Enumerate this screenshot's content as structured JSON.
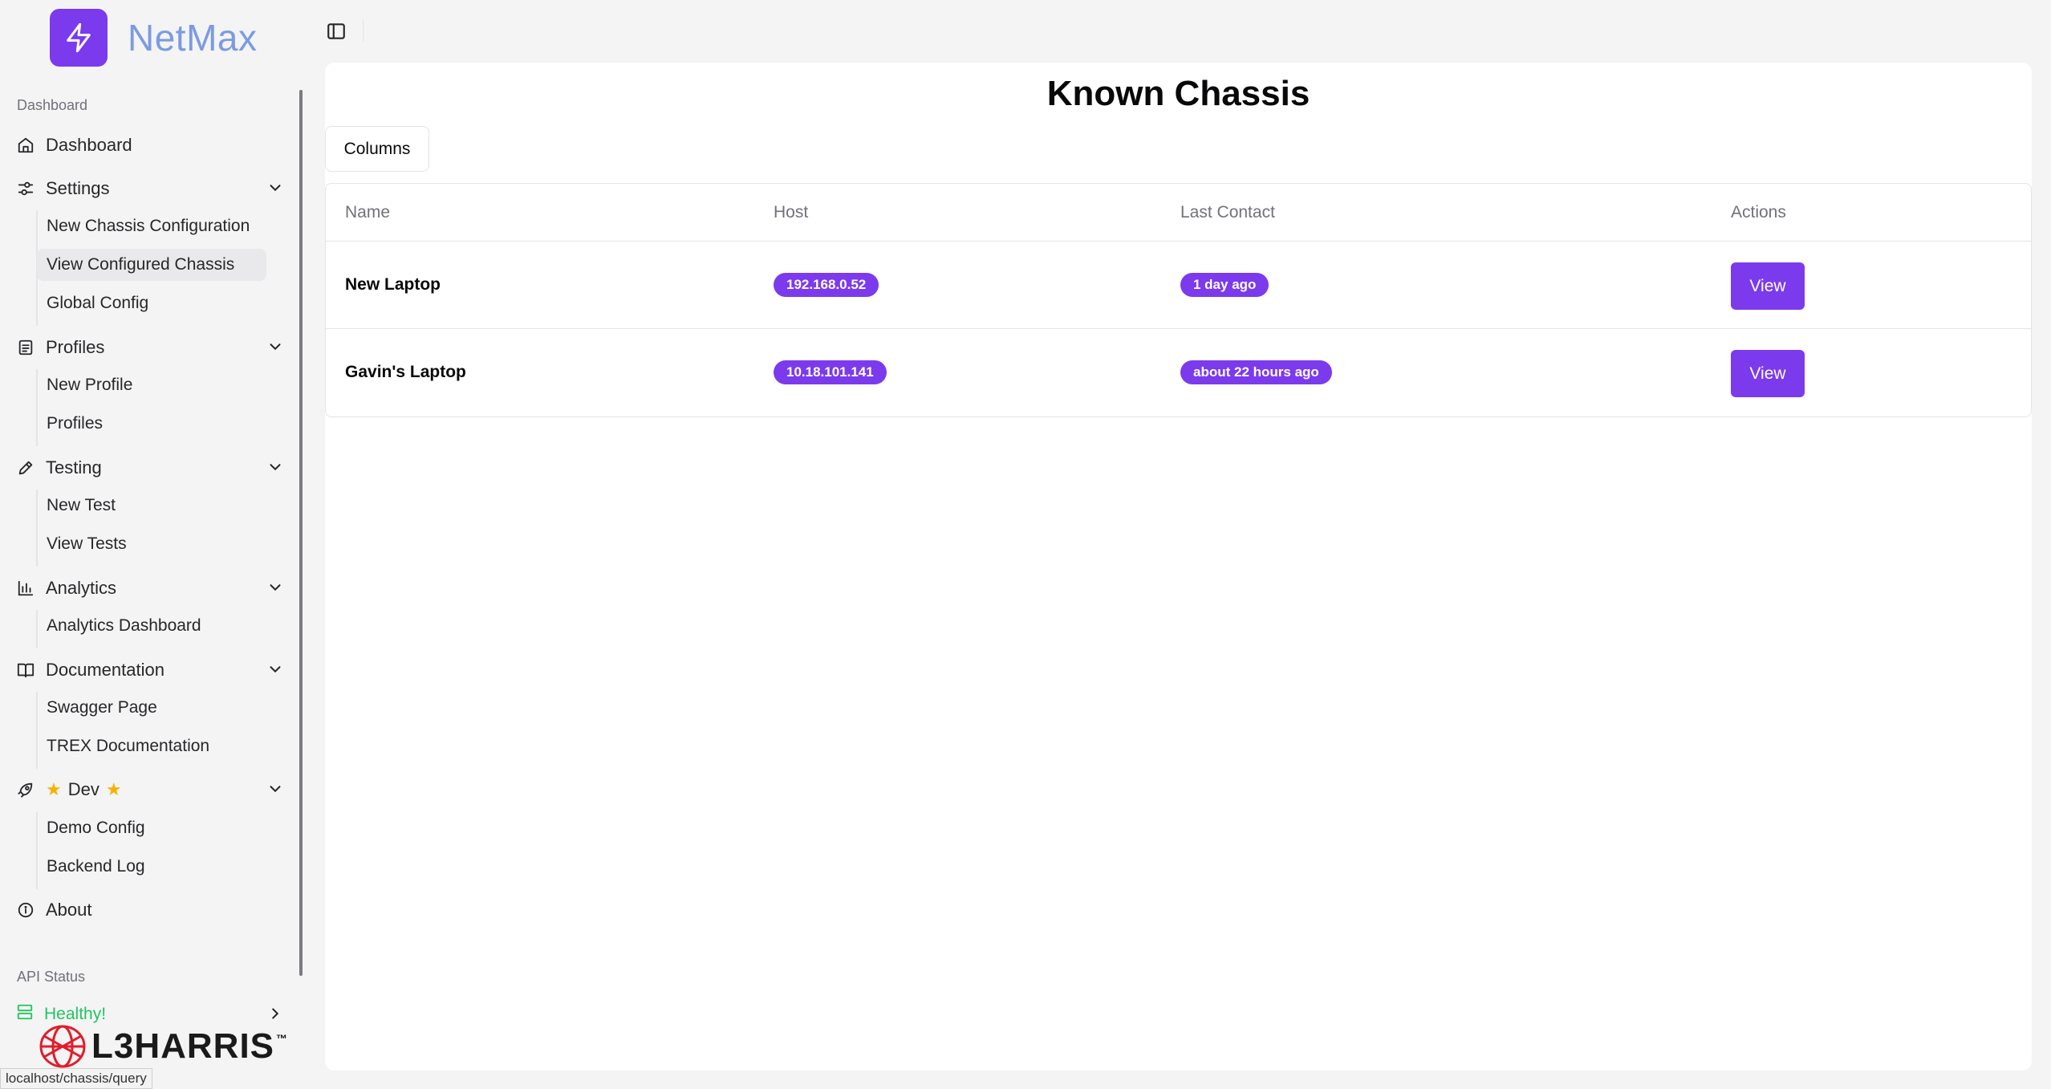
{
  "brand": {
    "name": "NetMax",
    "logo_icon": "lightning-bolt-icon",
    "accent": "#7c3aed"
  },
  "sidebar": {
    "group_dashboard": "Dashboard",
    "items": {
      "dashboard": "Dashboard",
      "settings": "Settings",
      "profiles": "Profiles",
      "testing": "Testing",
      "analytics": "Analytics",
      "documentation": "Documentation",
      "dev": "Dev",
      "about": "About"
    },
    "settings_sub": [
      "New Chassis Configuration",
      "View Configured Chassis",
      "Global Config"
    ],
    "profiles_sub": [
      "New Profile",
      "Profiles"
    ],
    "testing_sub": [
      "New Test",
      "View Tests"
    ],
    "analytics_sub": [
      "Analytics Dashboard"
    ],
    "documentation_sub": [
      "Swagger Page",
      "TREX Documentation"
    ],
    "dev_sub": [
      "Demo Config",
      "Backend Log"
    ],
    "group_api": "API Status",
    "api_status": "Healthy!",
    "api_status_color": "#22c55e"
  },
  "footer": {
    "logo_text": "L3HARRIS",
    "logo_tm": "™",
    "status_url": "localhost/chassis/query"
  },
  "main": {
    "title": "Known Chassis",
    "columns_button": "Columns",
    "table": {
      "headers": [
        "Name",
        "Host",
        "Last Contact",
        "Actions"
      ],
      "rows": [
        {
          "name": "New Laptop",
          "host": "192.168.0.52",
          "last_contact": "1 day ago",
          "action": "View"
        },
        {
          "name": "Gavin's Laptop",
          "host": "10.18.101.141",
          "last_contact": "about 22 hours ago",
          "action": "View"
        }
      ]
    }
  }
}
